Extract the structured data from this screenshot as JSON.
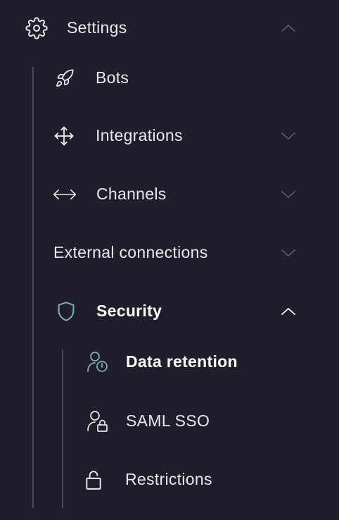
{
  "settings": {
    "label": "Settings",
    "icon": "gear-icon",
    "expanded": true,
    "items": [
      {
        "label": "Bots",
        "icon": "rocket-icon"
      },
      {
        "label": "Integrations",
        "icon": "move-arrows-icon",
        "expanded": false
      },
      {
        "label": "Channels",
        "icon": "horizontal-arrows-icon",
        "expanded": false
      },
      {
        "label": "External connections",
        "expanded": false
      }
    ]
  },
  "security": {
    "label": "Security",
    "icon": "shield-icon",
    "accent": "#7fb7b0",
    "expanded": true,
    "items": [
      {
        "label": "Data retention",
        "icon": "user-clock-icon",
        "active": true
      },
      {
        "label": "SAML SSO",
        "icon": "user-lock-icon"
      },
      {
        "label": "Restrictions",
        "icon": "padlock-icon"
      }
    ]
  }
}
